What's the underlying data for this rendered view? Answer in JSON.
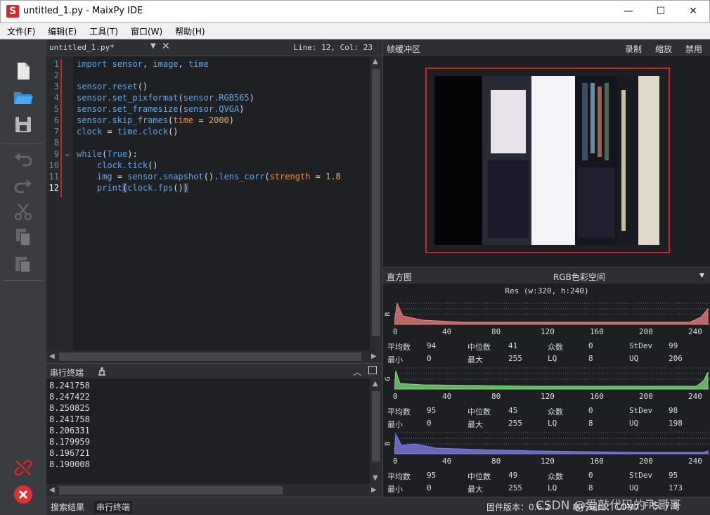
{
  "window": {
    "title": "untitled_1.py - MaixPy IDE",
    "logo": "S",
    "minimize": "—",
    "maximize": "☐",
    "close": "✕"
  },
  "menu": [
    "文件(F)",
    "编辑(E)",
    "工具(T)",
    "窗口(W)",
    "帮助(H)"
  ],
  "toolbar_icons": [
    "new-file-icon",
    "open-folder-icon",
    "save-icon",
    "undo-icon",
    "redo-icon",
    "cut-icon",
    "copy-icon",
    "paste-icon",
    "disconnect-icon",
    "stop-icon"
  ],
  "editor": {
    "filename": "untitled_1.py*",
    "dropdown": "▼",
    "close": "✕",
    "cursor_pos": "Line: 12, Col: 23",
    "line_numbers": [
      "1",
      "2",
      "3",
      "4",
      "5",
      "6",
      "7",
      "8",
      "9",
      "10",
      "11",
      "12"
    ],
    "fold_marker": "⌄"
  },
  "serial": {
    "title": "串行终端",
    "lines": [
      "8.241758",
      "8.247422",
      "8.250825",
      "8.241758",
      "8.206331",
      "8.179959",
      "8.196721",
      "8.190008"
    ]
  },
  "statusbar": {
    "tab_search": "搜索结果",
    "tab_serial": "串行终端",
    "firmware": "固件版本：0.6.2",
    "port": "串行端口：COM7",
    "fps": "FPS: 7.8",
    "watermark": "CSDN @爱敲代码的飞哥哥"
  },
  "framebuffer": {
    "title": "帧缓冲区",
    "record": "录制",
    "zoom": "缩放",
    "disable": "禁用"
  },
  "histogram": {
    "title": "直方图",
    "colorspace": "RGB色彩空间",
    "resolution": "Res (w:320, h:240)",
    "x_ticks": [
      "0",
      "40",
      "80",
      "120",
      "160",
      "200",
      "240"
    ],
    "labels": {
      "mean": "平均数",
      "median": "中位数",
      "mode": "众数",
      "stdev": "StDev",
      "min": "最小",
      "max": "最大",
      "lq": "LQ",
      "uq": "UQ"
    },
    "channels": [
      {
        "name": "R",
        "color": "#f08080",
        "mean": "94",
        "median": "41",
        "mode": "0",
        "stdev": "99",
        "min": "0",
        "max": "255",
        "lq": "8",
        "uq": "206"
      },
      {
        "name": "G",
        "color": "#80e080",
        "mean": "95",
        "median": "45",
        "mode": "0",
        "stdev": "98",
        "min": "0",
        "max": "255",
        "lq": "8",
        "uq": "198"
      },
      {
        "name": "B",
        "color": "#8080f0",
        "mean": "95",
        "median": "49",
        "mode": "0",
        "stdev": "95",
        "min": "0",
        "max": "255",
        "lq": "8",
        "uq": "173"
      }
    ]
  }
}
